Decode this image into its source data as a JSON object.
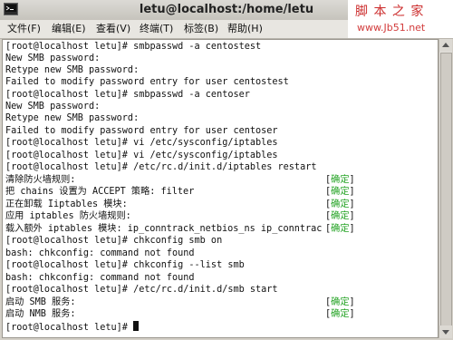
{
  "window": {
    "title": "letu@localhost:/home/letu"
  },
  "watermark": {
    "line1": "脚 本 之 家",
    "line2": "www.Jb51.net"
  },
  "menu": [
    {
      "label": "文件(F)"
    },
    {
      "label": "编辑(E)"
    },
    {
      "label": "查看(V)"
    },
    {
      "label": "终端(T)"
    },
    {
      "label": "标签(B)"
    },
    {
      "label": "帮助(H)"
    }
  ],
  "terminal": {
    "lines": [
      "[root@localhost letu]# smbpasswd -a centostest",
      "New SMB password:",
      "Retype new SMB password:",
      "Failed to modify password entry for user centostest",
      "[root@localhost letu]# smbpasswd -a centoser",
      "New SMB password:",
      "Retype new SMB password:",
      "Failed to modify password entry for user centoser",
      "[root@localhost letu]# vi /etc/sysconfig/iptables",
      "[root@localhost letu]# vi /etc/sysconfig/iptables",
      "[root@localhost letu]# /etc/rc.d/init.d/iptables restart",
      "清除防火墙规则:",
      "把 chains 设置为 ACCEPT 策略: filter",
      "正在卸载 Iiptables 模块:",
      "应用 iptables 防火墙规则:",
      "载入额外 iptables 模块: ip_conntrack_netbios_ns ip_conntrac",
      "[root@localhost letu]# chkconfig smb on",
      "bash: chkconfig: command not found",
      "[root@localhost letu]# chkconfig --list smb",
      "bash: chkconfig: command not found",
      "[root@localhost letu]# /etc/rc.d/init.d/smb start",
      "启动 SMB 服务:",
      "启动 NMB 服务:",
      "[root@localhost letu]# "
    ],
    "ok_label": "确定",
    "ok_color": "#22a222"
  }
}
